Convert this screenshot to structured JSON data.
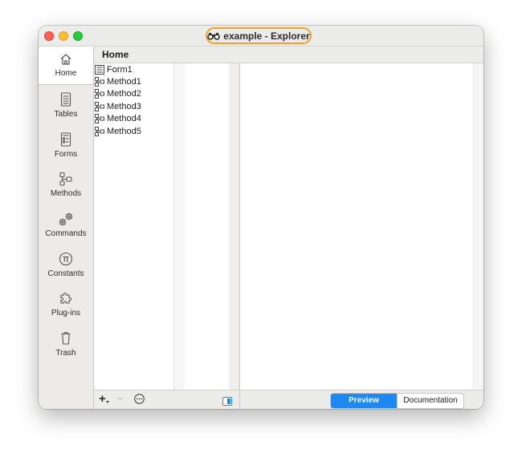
{
  "window": {
    "title": "example - Explorer",
    "title_icon": "binoculars-icon",
    "highlight_color": "#f0a030"
  },
  "sidebar": {
    "items": [
      {
        "label": "Home",
        "icon": "home-icon",
        "active": true
      },
      {
        "label": "Tables",
        "icon": "table-icon"
      },
      {
        "label": "Forms",
        "icon": "form-icon"
      },
      {
        "label": "Methods",
        "icon": "method-icon"
      },
      {
        "label": "Commands",
        "icon": "gears-icon"
      },
      {
        "label": "Constants",
        "icon": "pi-icon"
      },
      {
        "label": "Plug-ins",
        "icon": "puzzle-icon"
      },
      {
        "label": "Trash",
        "icon": "trash-icon"
      }
    ]
  },
  "header": {
    "title": "Home"
  },
  "list": {
    "items": [
      {
        "label": "Form1",
        "icon": "form-icon"
      },
      {
        "label": "Method1",
        "icon": "method-icon"
      },
      {
        "label": "Method2",
        "icon": "method-icon"
      },
      {
        "label": "Method3",
        "icon": "method-icon"
      },
      {
        "label": "Method4",
        "icon": "method-icon"
      },
      {
        "label": "Method5",
        "icon": "method-icon"
      }
    ]
  },
  "bottom_bar": {
    "add_label": "+",
    "remove_label": "−",
    "more_icon": "ellipsis-circle-icon",
    "panel_toggle_icon": "sidebar-toggle-icon"
  },
  "preview_tabs": {
    "preview_label": "Preview",
    "documentation_label": "Documentation",
    "selected": "Preview",
    "accent": "#1e87f0"
  }
}
